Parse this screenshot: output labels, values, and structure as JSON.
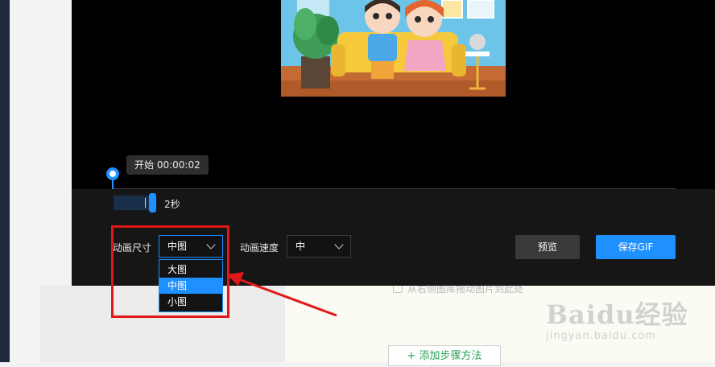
{
  "timeline": {
    "start_tooltip": "开始 00:00:02",
    "duration_label": "2秒"
  },
  "size_control": {
    "label": "动画尺寸",
    "value": "中图",
    "options": [
      "大图",
      "中图",
      "小图"
    ],
    "selected_option": "中图"
  },
  "speed_control": {
    "label": "动画速度",
    "value": "中"
  },
  "buttons": {
    "preview": "预览",
    "save_gif": "保存GIF"
  },
  "page": {
    "drop_hint": "从右侧图库拖动图片到此处",
    "add_step": "+ 添加步骤方法"
  },
  "watermark": {
    "main": "Baidu经验",
    "sub": "jingyan.baidu.com"
  },
  "colors": {
    "accent": "#1e90ff",
    "annotation": "#e21818",
    "add_step_text": "#28a35a"
  }
}
